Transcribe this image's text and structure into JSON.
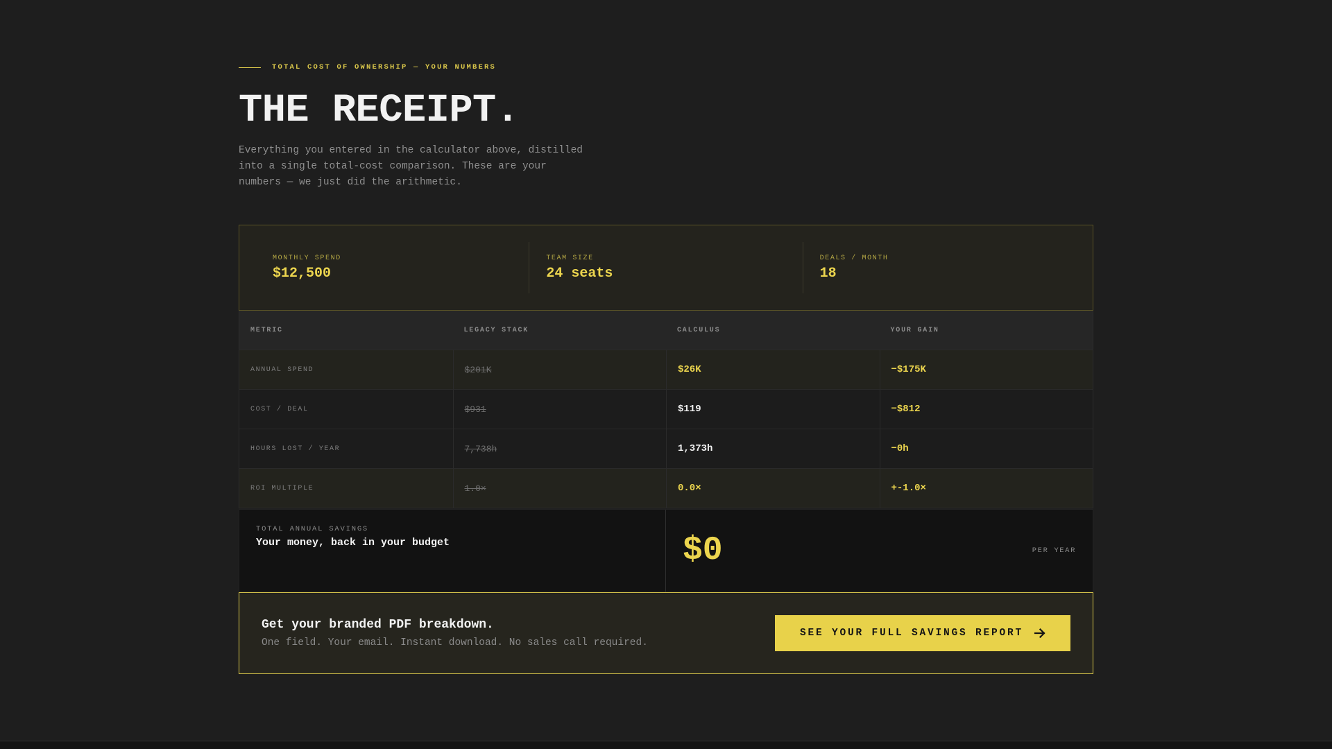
{
  "section": {
    "eyebrow": "TOTAL COST OF OWNERSHIP — YOUR NUMBERS",
    "title": "THE RECEIPT.",
    "intro": "Everything you entered in the calculator above, distilled into a single total-cost comparison. These are your numbers — we just did the arithmetic."
  },
  "inputs": [
    {
      "label": "MONTHLY SPEND",
      "value": "$12,500"
    },
    {
      "label": "TEAM SIZE",
      "value": "24 seats"
    },
    {
      "label": "DEALS / MONTH",
      "value": "18"
    }
  ],
  "table": {
    "headers": [
      "METRIC",
      "LEGACY STACK",
      "CALCULUS",
      "YOUR GAIN"
    ],
    "rows": [
      {
        "metric": "ANNUAL SPEND",
        "legacy": "$201K",
        "calculus": "$26K",
        "gain": "−$175K"
      },
      {
        "metric": "COST / DEAL",
        "legacy": "$931",
        "calculus": "$119",
        "gain": "−$812"
      },
      {
        "metric": "HOURS LOST / YEAR",
        "legacy": "7,738h",
        "calculus": "1,373h",
        "gain": "−0h"
      },
      {
        "metric": "ROI MULTIPLE",
        "legacy": "1.0×",
        "calculus": "0.0×",
        "gain": "+-1.0×"
      }
    ]
  },
  "totals": {
    "label": "TOTAL ANNUAL SAVINGS",
    "subtitle": "Your money, back in your budget",
    "value": "$0",
    "unit": "PER YEAR"
  },
  "cta": {
    "title": "Get your branded PDF breakdown.",
    "subtitle": "One field. Your email. Instant download. No sales call required.",
    "button_label": "SEE YOUR FULL SAVINGS REPORT",
    "button_icon": "arrow-right-icon"
  },
  "colors": {
    "background": "#1e1e1e",
    "accent": "#e8d24a",
    "muted_text": "#8f8f8f"
  }
}
